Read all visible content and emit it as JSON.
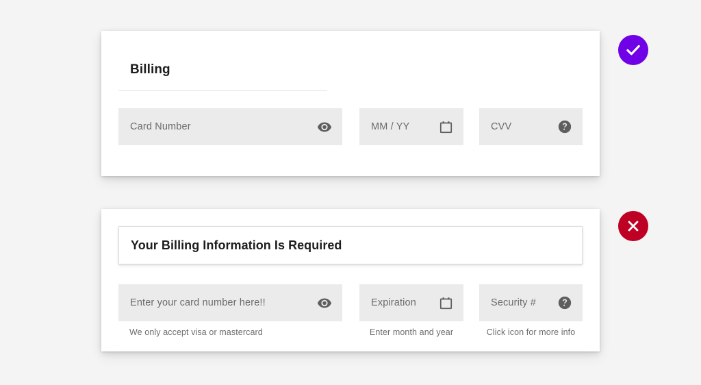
{
  "page": {
    "background_color": "#f4f4f4"
  },
  "billing_card": {
    "title": "Billing",
    "fields": [
      {
        "label": "Card Number",
        "icon": "eye-icon",
        "helper": ""
      },
      {
        "label": "MM / YY",
        "icon": "calendar-icon",
        "helper": ""
      },
      {
        "label": "CVV",
        "icon": "help-circle-icon",
        "helper": ""
      }
    ]
  },
  "required_card": {
    "notice": "Your Billing Information Is Required",
    "fields": [
      {
        "label": "Enter your card number here!!",
        "icon": "eye-icon",
        "helper": "We only accept visa or mastercard"
      },
      {
        "label": "Expiration",
        "icon": "calendar-icon",
        "helper": "Enter month and year"
      },
      {
        "label": "Security #",
        "icon": "help-circle-icon",
        "helper": "Click icon for more info"
      }
    ]
  },
  "status_badges": {
    "success": {
      "icon": "check-icon",
      "color": "#7000e6"
    },
    "error": {
      "icon": "close-x-icon",
      "color": "#bd0024"
    }
  },
  "colors": {
    "field_background": "#ebebeb",
    "card_background": "#ffffff",
    "label_text": "#6b6b6b",
    "title_text": "#1d1d1d",
    "helper_text": "#6d6d6d",
    "icon": "#5e5e5e",
    "rule": "#e4e4e4"
  }
}
